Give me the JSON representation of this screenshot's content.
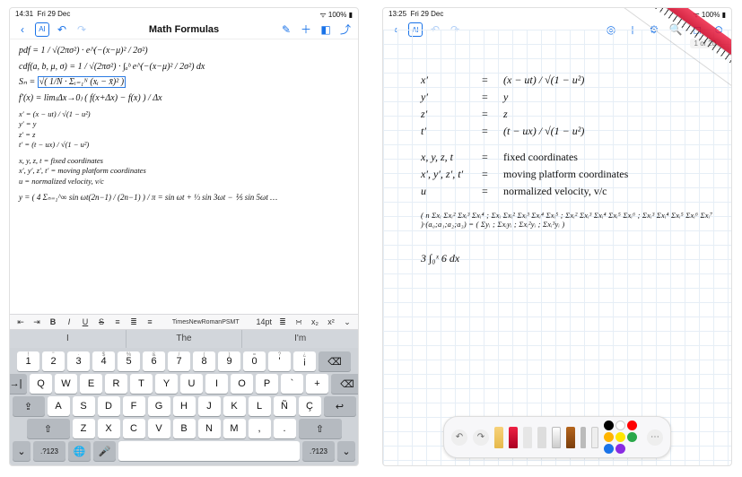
{
  "left": {
    "status": {
      "time": "14:31",
      "date": "Fri 29 Dec",
      "battery": "100%"
    },
    "title": "Math Formulas",
    "lines": {
      "l1": "pdf = 1 / √(2πσ²) · e^(−(x−μ)² / 2σ²)",
      "l2": "cdf(a, b, μ, σ) = 1 / √(2πσ²) · ∫ₐᵇ e^(−(x−μ)² / 2σ²) dx",
      "l3a": "Sₙ = ",
      "l3b": "√( 1/N · Σᵢ₌₁ᴺ (xᵢ − x̄)² )",
      "l4": "f′(x) = lim₍Δx→0₎ ( f(x+Δx) − f(x) ) / Δx",
      "p1": "x′        =    (x − ut) / √(1 − u²)",
      "p2": "y′        =    y",
      "p3": "z′        =    z",
      "p4": "t′        =    (t − ux) / √(1 − u²)",
      "d1": "x, y, z, t     =   fixed coordinates",
      "d2": "x′, y′, z′, t′  =   moving platform coordinates",
      "d3": "u              =   normalized velocity, v/c",
      "s1": "y = ( 4 Σₙ₌₁^∞ sin ωt(2n−1) / (2n−1) ) / π  =  sin ωt + ⅓ sin 3ωt − ⅕ sin 5ωt …"
    },
    "fmt": {
      "font": "TimesNewRomanPSMT",
      "size": "14pt"
    },
    "sugg": {
      "a": "I",
      "b": "The",
      "c": "I'm"
    },
    "rows": {
      "num": [
        [
          "!",
          "1"
        ],
        [
          "\"",
          "2"
        ],
        [
          "·",
          "3"
        ],
        [
          "$",
          "4"
        ],
        [
          "%",
          "5"
        ],
        [
          "&",
          "6"
        ],
        [
          "/",
          "7"
        ],
        [
          "(",
          "8"
        ],
        [
          ")",
          "9"
        ],
        [
          "=",
          "0"
        ],
        [
          "?",
          "'"
        ],
        [
          "¿",
          "¡"
        ]
      ],
      "r1": [
        "Q",
        "W",
        "E",
        "R",
        "T",
        "Y",
        "U",
        "I",
        "O",
        "P"
      ],
      "r2": [
        "A",
        "S",
        "D",
        "F",
        "G",
        "H",
        "J",
        "K",
        "L",
        "Ñ"
      ],
      "r3": [
        "Z",
        "X",
        "C",
        "V",
        "B",
        "N",
        "M"
      ]
    },
    "keys": {
      "tab": "→|",
      "caps": "⇪",
      "shift": "⇧",
      "del": "⌫",
      "globe": "🌐",
      "mic": "🎤",
      "numtoggle": ".?123",
      "enter": "↩︎",
      "comma": ",",
      "period": ".",
      "semicolon": ";",
      "colon": ":",
      "hide": "⌄",
      "grave": "`",
      "plus": "+",
      "cedilla": "Ç"
    }
  },
  "right": {
    "status": {
      "time": "13:25",
      "date": "Fri 29 Dec",
      "battery": "100%"
    },
    "page": "1 of 20",
    "eq": {
      "x": "(x − ut) / √(1 − u²)",
      "y": "y",
      "z": "z",
      "t": "(t − ux) / √(1 − u²)"
    },
    "def": {
      "d1": "fixed coordinates",
      "d2": "moving platform coordinates",
      "d3": "normalized velocity, v/c"
    },
    "labels": {
      "x": "x′",
      "y": "y′",
      "z": "z′",
      "t": "t′",
      "c1": "x, y, z, t",
      "c2": "x′, y′, z′, t′",
      "c3": "u",
      "eq": "="
    },
    "matrix": "( n  Σxᵢ  Σxᵢ²  Σxᵢ³  Σxᵢ⁴ ; Σxᵢ  Σxᵢ²  Σxᵢ³  Σxᵢ⁴  Σxᵢ⁵ ; Σxᵢ²  Σxᵢ³  Σxᵢ⁴  Σxᵢ⁵  Σxᵢ⁶ ; Σxᵢ³  Σxᵢ⁴  Σxᵢ⁵  Σxᵢ⁶  Σxᵢ⁷ )·(a₀;a₁;a₂;a₃) = ( Σyᵢ ; Σxᵢyᵢ ; Σxᵢ²yᵢ ; Σxᵢ³yᵢ )",
    "last": "3 ∫₀ˣ 6 dx",
    "palette": {
      "colors": [
        "#000",
        "#fff",
        "#f00",
        "#ffb400",
        "#ffe600",
        "#2aa84a",
        "#1a73e8",
        "#8a2be2"
      ]
    }
  }
}
